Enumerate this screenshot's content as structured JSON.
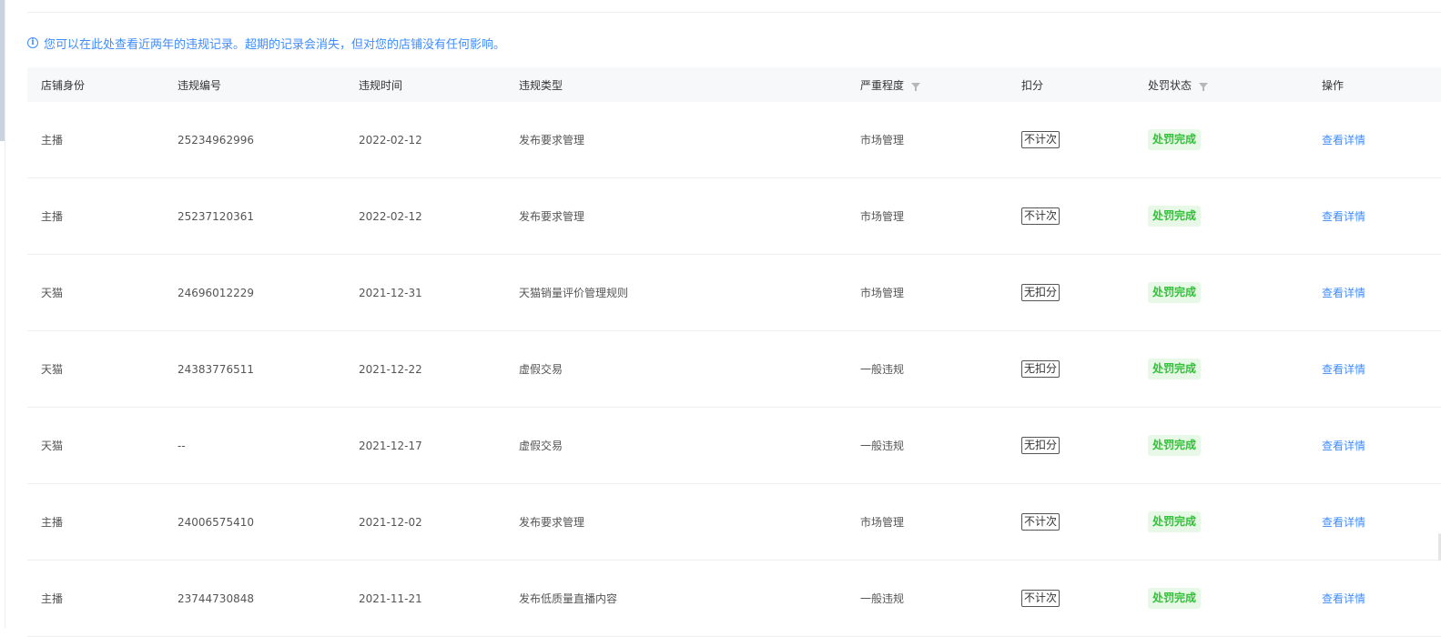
{
  "notice": {
    "icon": "info-icon",
    "text": "您可以在此处查看近两年的违规记录。超期的记录会消失，但对您的店铺没有任何影响。"
  },
  "table": {
    "headers": {
      "shop_identity": "店铺身份",
      "violation_id": "违规编号",
      "violation_time": "违规时间",
      "violation_type": "违规类型",
      "severity": "严重程度",
      "deduction": "扣分",
      "penalty_status": "处罚状态",
      "action": "操作"
    },
    "rows": [
      {
        "identity": "主播",
        "id": "25234962996",
        "time": "2022-02-12",
        "type": "发布要求管理",
        "severity": "市场管理",
        "deduction": "不计次",
        "status": "处罚完成",
        "action": "查看详情"
      },
      {
        "identity": "主播",
        "id": "25237120361",
        "time": "2022-02-12",
        "type": "发布要求管理",
        "severity": "市场管理",
        "deduction": "不计次",
        "status": "处罚完成",
        "action": "查看详情"
      },
      {
        "identity": "天猫",
        "id": "24696012229",
        "time": "2021-12-31",
        "type": "天猫销量评价管理规则",
        "severity": "市场管理",
        "deduction": "无扣分",
        "status": "处罚完成",
        "action": "查看详情"
      },
      {
        "identity": "天猫",
        "id": "24383776511",
        "time": "2021-12-22",
        "type": "虚假交易",
        "severity": "一般违规",
        "deduction": "无扣分",
        "status": "处罚完成",
        "action": "查看详情"
      },
      {
        "identity": "天猫",
        "id": "--",
        "time": "2021-12-17",
        "type": "虚假交易",
        "severity": "一般违规",
        "deduction": "无扣分",
        "status": "处罚完成",
        "action": "查看详情"
      },
      {
        "identity": "主播",
        "id": "24006575410",
        "time": "2021-12-02",
        "type": "发布要求管理",
        "severity": "市场管理",
        "deduction": "不计次",
        "status": "处罚完成",
        "action": "查看详情"
      },
      {
        "identity": "主播",
        "id": "23744730848",
        "time": "2021-11-21",
        "type": "发布低质量直播内容",
        "severity": "一般违规",
        "deduction": "不计次",
        "status": "处罚完成",
        "action": "查看详情"
      }
    ]
  },
  "colors": {
    "accent": "#3f8cff",
    "status_bg": "#e8f8e6",
    "status_text": "#33c13a",
    "header_bg": "#f7f8fa"
  }
}
